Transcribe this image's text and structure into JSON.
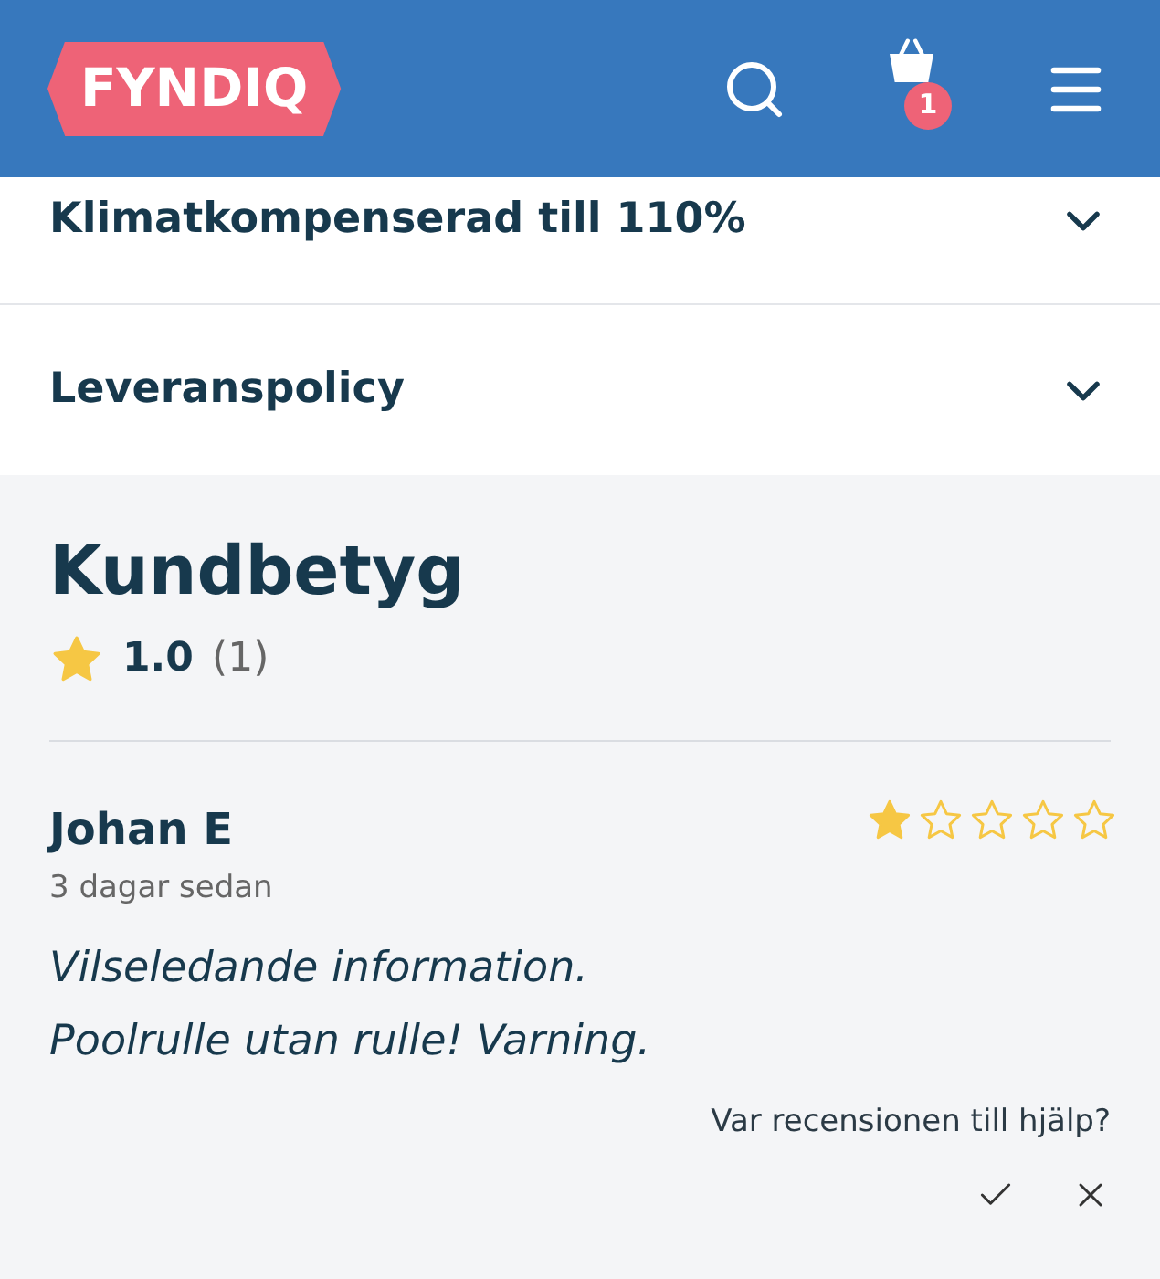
{
  "header": {
    "logo": "FYNDIQ",
    "cart_count": "1"
  },
  "accordions": [
    {
      "title": "Klimatkompenserad till 110%",
      "expanded": false
    },
    {
      "title": "Leveranspolicy",
      "expanded": false
    }
  ],
  "ratings": {
    "title": "Kundbetyg",
    "average": "1.0",
    "count": "(1)",
    "reviews": [
      {
        "author": "Johan E",
        "stars": 1,
        "date": "3 dagar sedan",
        "lines": [
          "Vilseledande information.",
          "Poolrulle utan rulle! Varning."
        ],
        "helpful_question": "Var recensionen till hjälp?"
      }
    ]
  }
}
